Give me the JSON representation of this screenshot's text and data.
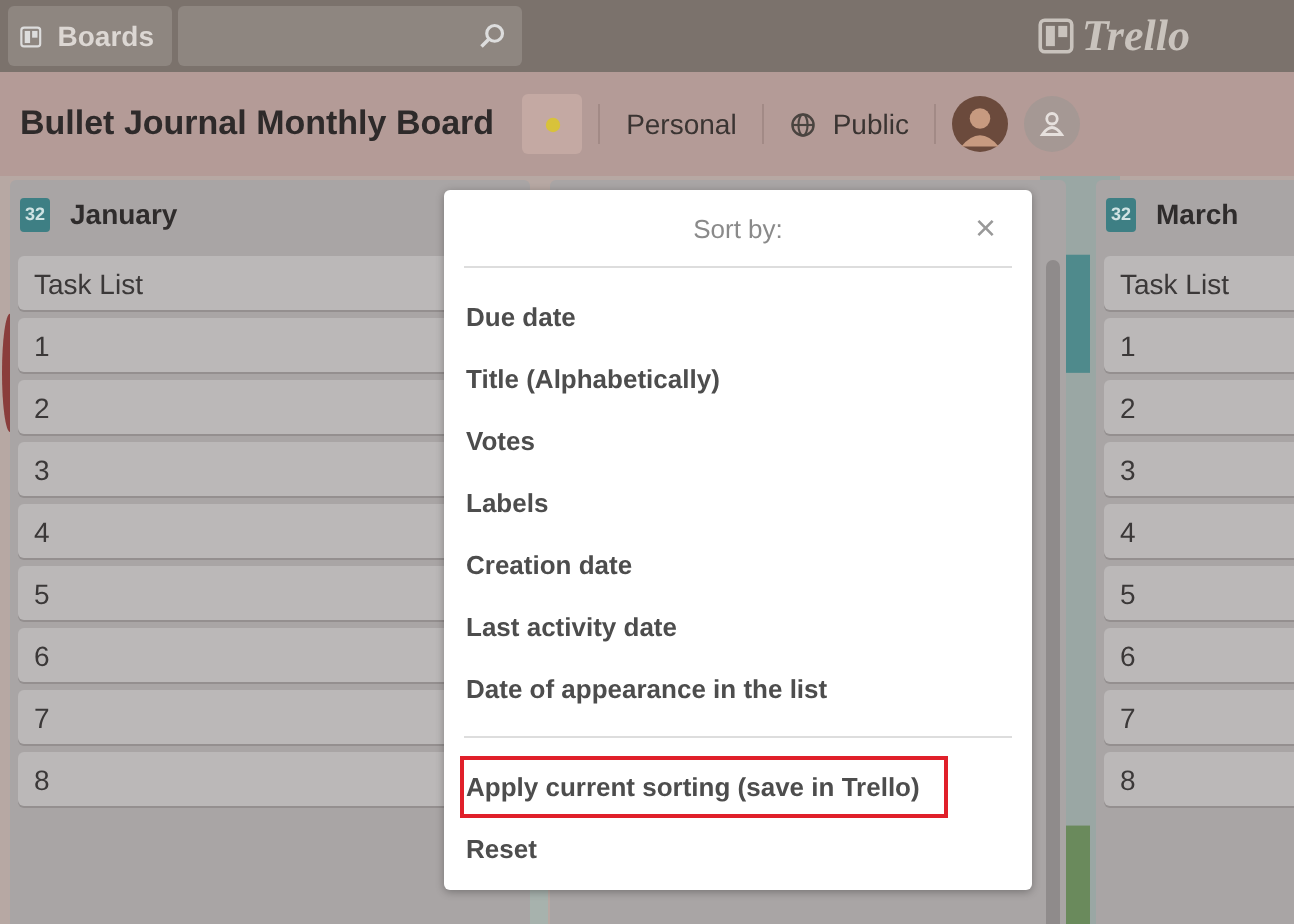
{
  "topbar": {
    "boards_button": "Boards",
    "logo": "Trello"
  },
  "board_header": {
    "title": "Bullet Journal Monthly Board",
    "visibility_team": "Personal",
    "visibility": "Public"
  },
  "lists": [
    {
      "kind": "list",
      "badge": "32",
      "title": "January",
      "cards": [
        "Task List",
        "1",
        "2",
        "3",
        "4",
        "5",
        "6",
        "7",
        "8"
      ]
    },
    {
      "kind": "hidden"
    },
    {
      "kind": "list",
      "badge": "32",
      "title": "March",
      "cards": [
        "Task List",
        "1",
        "2",
        "3",
        "4",
        "5",
        "6",
        "7",
        "8"
      ]
    }
  ],
  "sort_popup": {
    "title": "Sort by:",
    "close": "×",
    "options": [
      {
        "label": "Due date"
      },
      {
        "label": "Title (Alphabetically)"
      },
      {
        "label": "Votes"
      },
      {
        "label": "Labels"
      },
      {
        "label": "Creation date"
      },
      {
        "label": "Last activity date"
      },
      {
        "label": "Date of appearance in the list"
      }
    ],
    "actions": [
      {
        "label": "Apply current sorting (save in Trello)",
        "highlighted": true
      },
      {
        "label": "Reset",
        "highlighted": false
      }
    ]
  }
}
